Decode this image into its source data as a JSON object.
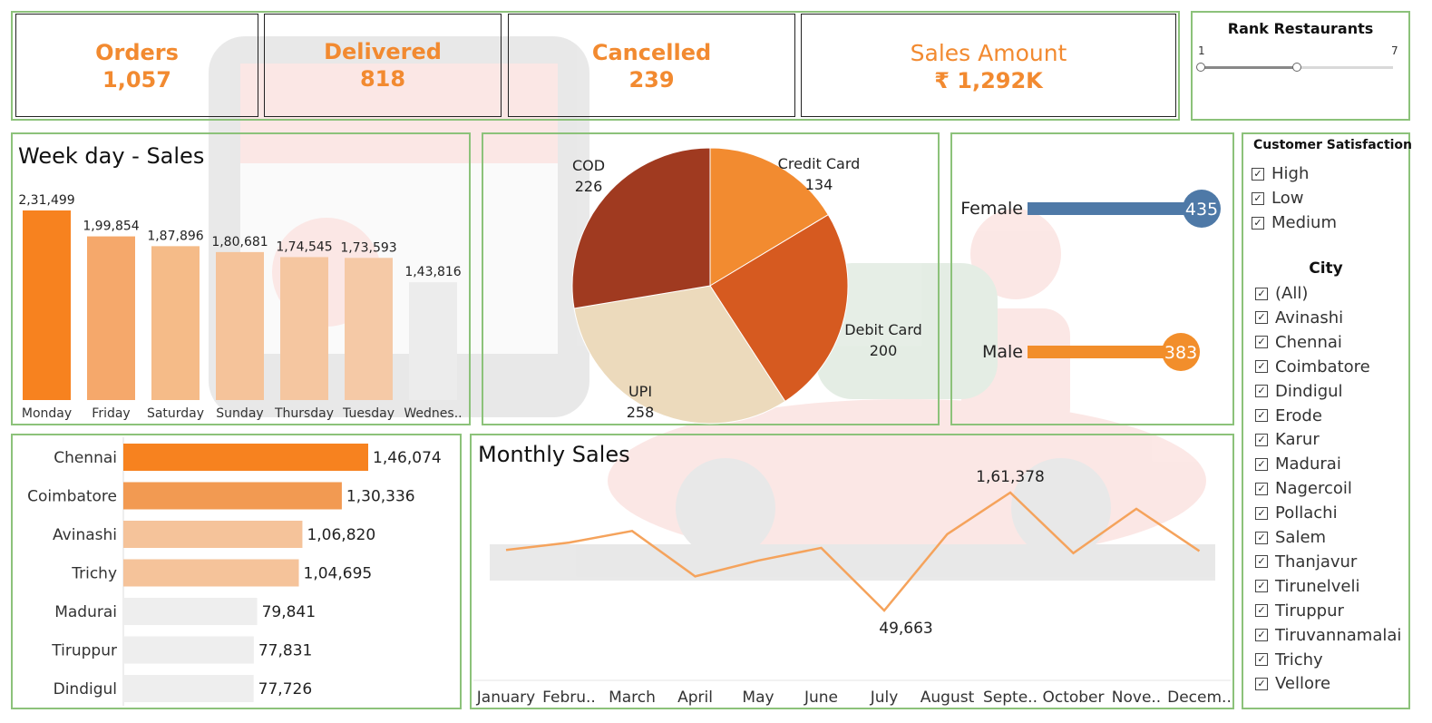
{
  "kpis": {
    "orders": {
      "label": "Orders",
      "value": "1,057"
    },
    "delivered": {
      "label": "Delivered",
      "value": "818"
    },
    "cancelled": {
      "label": "Cancelled",
      "value": "239"
    },
    "sales_amount": {
      "label": "Sales Amount",
      "value": "₹ 1,292K"
    }
  },
  "rank_filter": {
    "title": "Rank Restaurants",
    "min_label": "1",
    "max_label": "7",
    "min": 1,
    "max": 7,
    "low": 1,
    "high": 4
  },
  "customer_satisfaction": {
    "title": "Customer Satisfaction",
    "options": [
      {
        "label": "High",
        "checked": "✓"
      },
      {
        "label": "Low",
        "checked": "✓"
      },
      {
        "label": "Medium",
        "checked": "✓"
      }
    ]
  },
  "city_filter": {
    "title": "City",
    "options": [
      {
        "label": "(All)"
      },
      {
        "label": "Avinashi"
      },
      {
        "label": "Chennai"
      },
      {
        "label": "Coimbatore"
      },
      {
        "label": "Dindigul"
      },
      {
        "label": "Erode"
      },
      {
        "label": "Karur"
      },
      {
        "label": "Madurai"
      },
      {
        "label": "Nagercoil"
      },
      {
        "label": "Pollachi"
      },
      {
        "label": "Salem"
      },
      {
        "label": "Thanjavur"
      },
      {
        "label": "Tirunelveli"
      },
      {
        "label": "Tiruppur"
      },
      {
        "label": "Tiruvannamalai"
      },
      {
        "label": "Trichy"
      },
      {
        "label": "Vellore"
      }
    ],
    "check_glyph": "✓"
  },
  "colors": {
    "accent": "#f28a30",
    "panel_border": "#8cc27a",
    "female": "#4e79a7",
    "male": "#f28e2b"
  },
  "chart_data": [
    {
      "type": "bar",
      "title": "Week day - Sales",
      "categories": [
        "Monday",
        "Friday",
        "Saturday",
        "Sunday",
        "Thursday",
        "Tuesday",
        "Wednes.."
      ],
      "values": [
        231499,
        199854,
        187896,
        180681,
        174545,
        173593,
        143816
      ],
      "value_labels": [
        "2,31,499",
        "1,99,854",
        "1,87,896",
        "1,80,681",
        "1,74,545",
        "1,73,593",
        "1,43,816"
      ],
      "colors": [
        "#f7821f",
        "#f5a86b",
        "#f5bb88",
        "#f5c39a",
        "#f5c6a0",
        "#f5c9a6",
        "#ececec"
      ],
      "ylim": [
        0,
        231499
      ]
    },
    {
      "type": "pie",
      "slices": [
        {
          "label": "Credit Card",
          "value": 134,
          "color": "#f28b30"
        },
        {
          "label": "Debit Card",
          "value": 200,
          "color": "#d65a20"
        },
        {
          "label": "UPI",
          "value": 258,
          "color": "#ecdabc"
        },
        {
          "label": "COD",
          "value": 226,
          "color": "#a03a20"
        }
      ]
    },
    {
      "type": "bar",
      "orientation": "horizontal",
      "categories": [
        "Female",
        "Male"
      ],
      "values": [
        435,
        383
      ],
      "colors": [
        "#4e79a7",
        "#f28e2b"
      ]
    },
    {
      "type": "bar",
      "orientation": "horizontal",
      "categories": [
        "Chennai",
        "Coimbatore",
        "Avinashi",
        "Trichy",
        "Madurai",
        "Tiruppur",
        "Dindigul"
      ],
      "values": [
        146074,
        130336,
        106820,
        104695,
        79841,
        77831,
        77726
      ],
      "value_labels": [
        "1,46,074",
        "1,30,336",
        "1,06,820",
        "1,04,695",
        "79,841",
        "77,831",
        "77,726"
      ],
      "colors": [
        "#f7821f",
        "#f29a52",
        "#f5c39a",
        "#f5c39a",
        "#eeeeee",
        "#eeeeee",
        "#eeeeee"
      ]
    },
    {
      "type": "line",
      "title": "Monthly Sales",
      "categories": [
        "January",
        "Febru..",
        "March",
        "April",
        "May",
        "June",
        "July",
        "August",
        "Septe..",
        "October",
        "Nove..",
        "Decem.."
      ],
      "values": [
        107000,
        114000,
        125000,
        82000,
        97000,
        109000,
        49663,
        122000,
        161378,
        104000,
        146000,
        106000
      ],
      "annotations": [
        {
          "index": 6,
          "label": "49,663"
        },
        {
          "index": 8,
          "label": "1,61,378"
        }
      ],
      "color": "#f5a35c"
    }
  ]
}
